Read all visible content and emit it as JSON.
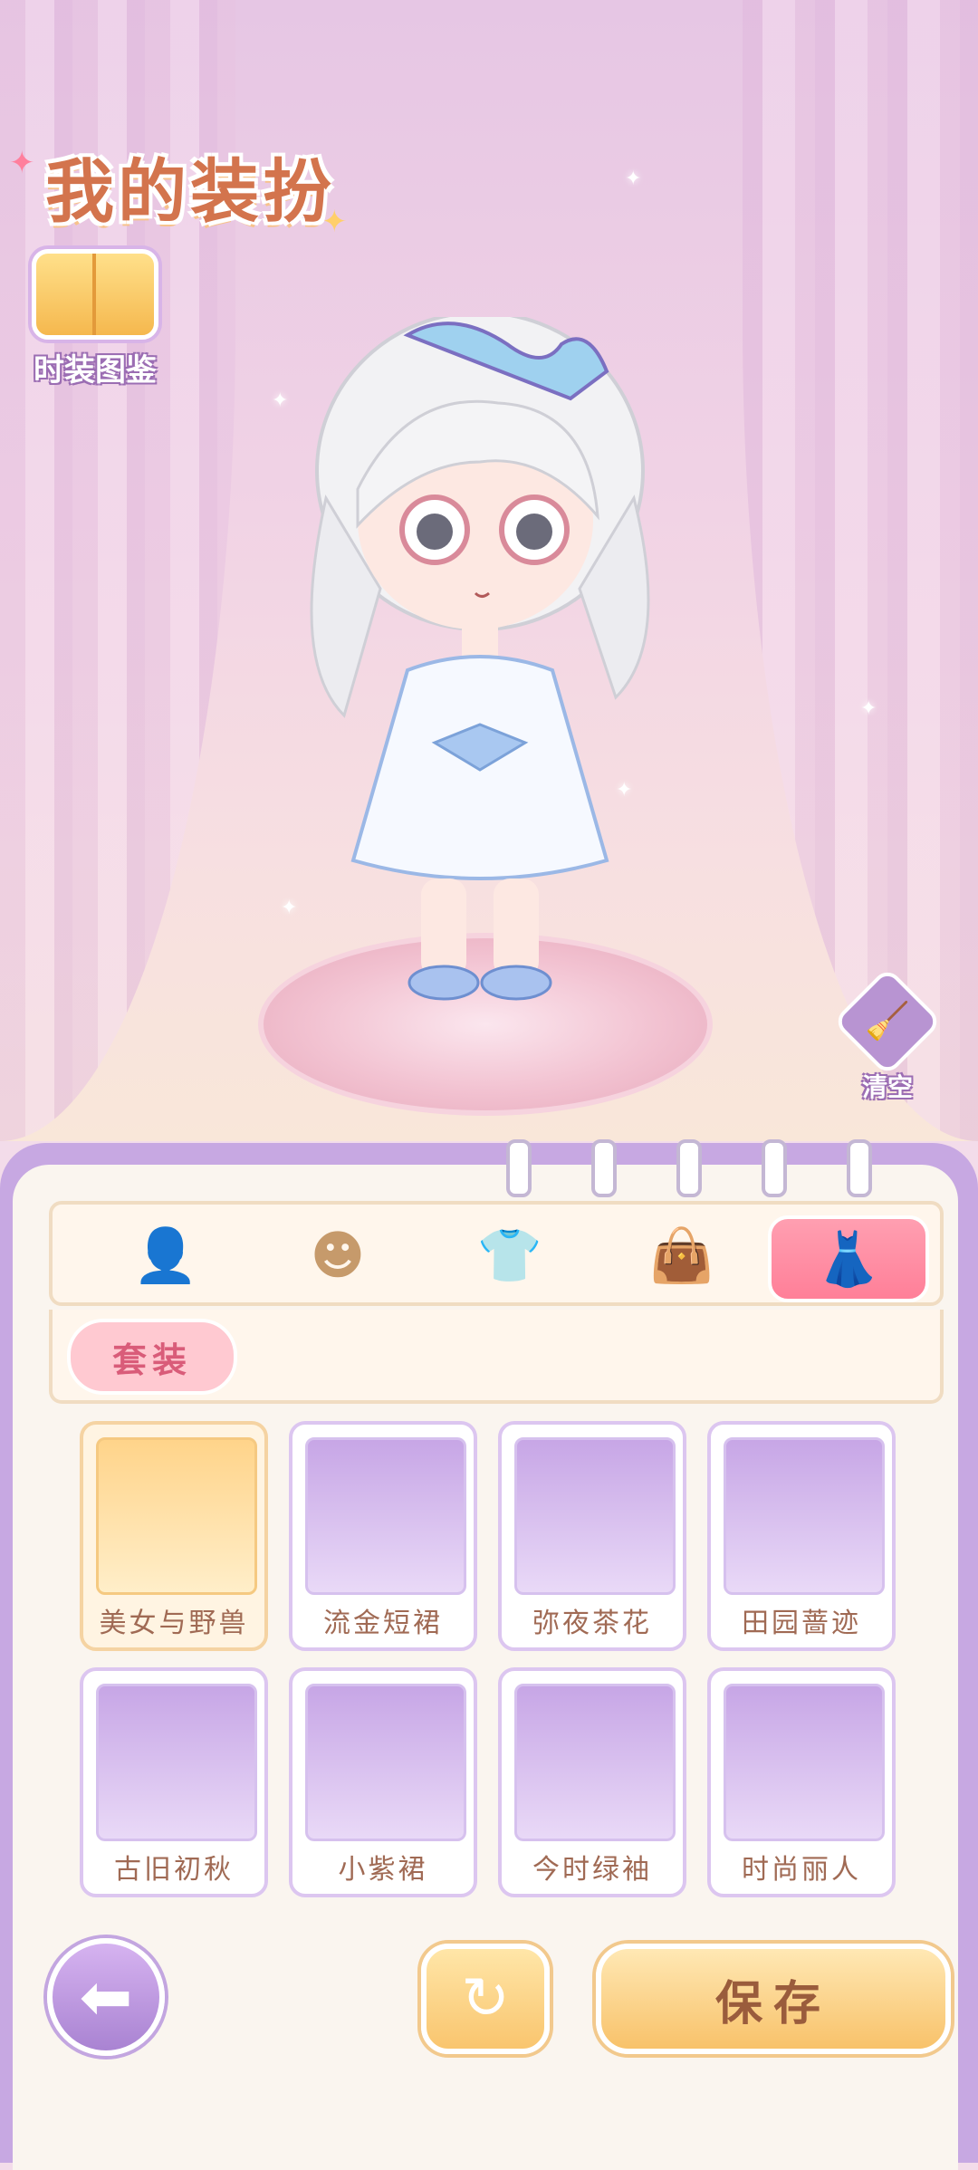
{
  "header": {
    "title": "我的装扮"
  },
  "catalog": {
    "label": "时装图鉴"
  },
  "tools": {
    "clear_label": "清空"
  },
  "tabs": [
    {
      "name": "hair",
      "icon": "hair-silhouette-icon"
    },
    {
      "name": "face",
      "icon": "face-icon"
    },
    {
      "name": "top",
      "icon": "tshirt-icon"
    },
    {
      "name": "accessory",
      "icon": "bag-icon"
    },
    {
      "name": "outfit",
      "icon": "dress-icon",
      "active": true
    }
  ],
  "subcategory": {
    "label": "套装"
  },
  "outfits": [
    {
      "name": "美女与野兽",
      "selected": true
    },
    {
      "name": "流金短裙"
    },
    {
      "name": "弥夜茶花"
    },
    {
      "name": "田园蔷迹"
    },
    {
      "name": "古旧初秋"
    },
    {
      "name": "小紫裙"
    },
    {
      "name": "今时绿袖"
    },
    {
      "name": "时尚丽人"
    }
  ],
  "actions": {
    "save_label": "保存",
    "back_icon": "arrow-left-icon",
    "reset_icon": "refresh-icon"
  },
  "colors": {
    "accent_pink": "#ff8fa6",
    "panel_purple": "#c7a8e2",
    "gold": "#f8c26a"
  }
}
